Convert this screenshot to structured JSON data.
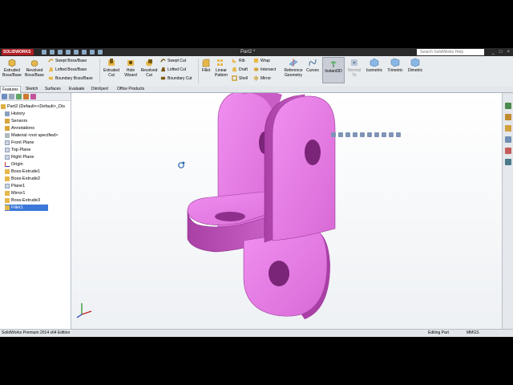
{
  "app": {
    "logo_text": "SOLIDWORKS",
    "document_title": "Part2 *",
    "help_search_placeholder": "Search SolidWorks Help",
    "window_buttons": [
      "_",
      "□",
      "×"
    ]
  },
  "ribbon": {
    "extruded_boss": "Extruded Boss/Base",
    "revolved_boss": "Revolved Boss/Base",
    "swept_boss": "Swept Boss/Base",
    "lofted_boss": "Lofted Boss/Base",
    "boundary_boss": "Boundary Boss/Base",
    "extruded_cut": "Extruded Cut",
    "hole_wizard": "Hole Wizard",
    "revolved_cut": "Revolved Cut",
    "swept_cut": "Swept Cut",
    "lofted_cut": "Lofted Cut",
    "boundary_cut": "Boundary Cut",
    "fillet": "Fillet",
    "linear_pattern": "Linear Pattern",
    "rib": "Rib",
    "draft": "Draft",
    "shell": "Shell",
    "wrap": "Wrap",
    "intersect": "Intersect",
    "mirror": "Mirror",
    "reference_geometry": "Reference Geometry",
    "curves": "Curves",
    "instant3d": "Instant3D",
    "normal_to": "Normal To",
    "isometric": "Isometric",
    "trimetric": "Trimetric",
    "dimetric": "Dimetric"
  },
  "tabs": [
    "Features",
    "Sketch",
    "Surfaces",
    "Evaluate",
    "DimXpert",
    "Office Products"
  ],
  "tree": [
    "Part2  (Default<<Default>_Dis",
    "History",
    "Sensors",
    "Annotations",
    "Material <not specified>",
    "Front Plane",
    "Top Plane",
    "Right Plane",
    "Origin",
    "Boss-Extrude1",
    "Boss-Extrude2",
    "Plane1",
    "Mirror1",
    "Boss-Extrude3",
    "Fillet1"
  ],
  "status": {
    "edition": "SolidWorks Premium 2014 x64 Edition",
    "mode": "Editing Part",
    "units": "MMGS"
  },
  "colors": {
    "part_face": "#e27ee0",
    "part_side": "#b94bb6",
    "part_dark": "#8f2f8c",
    "selection": "#3c78d8"
  }
}
